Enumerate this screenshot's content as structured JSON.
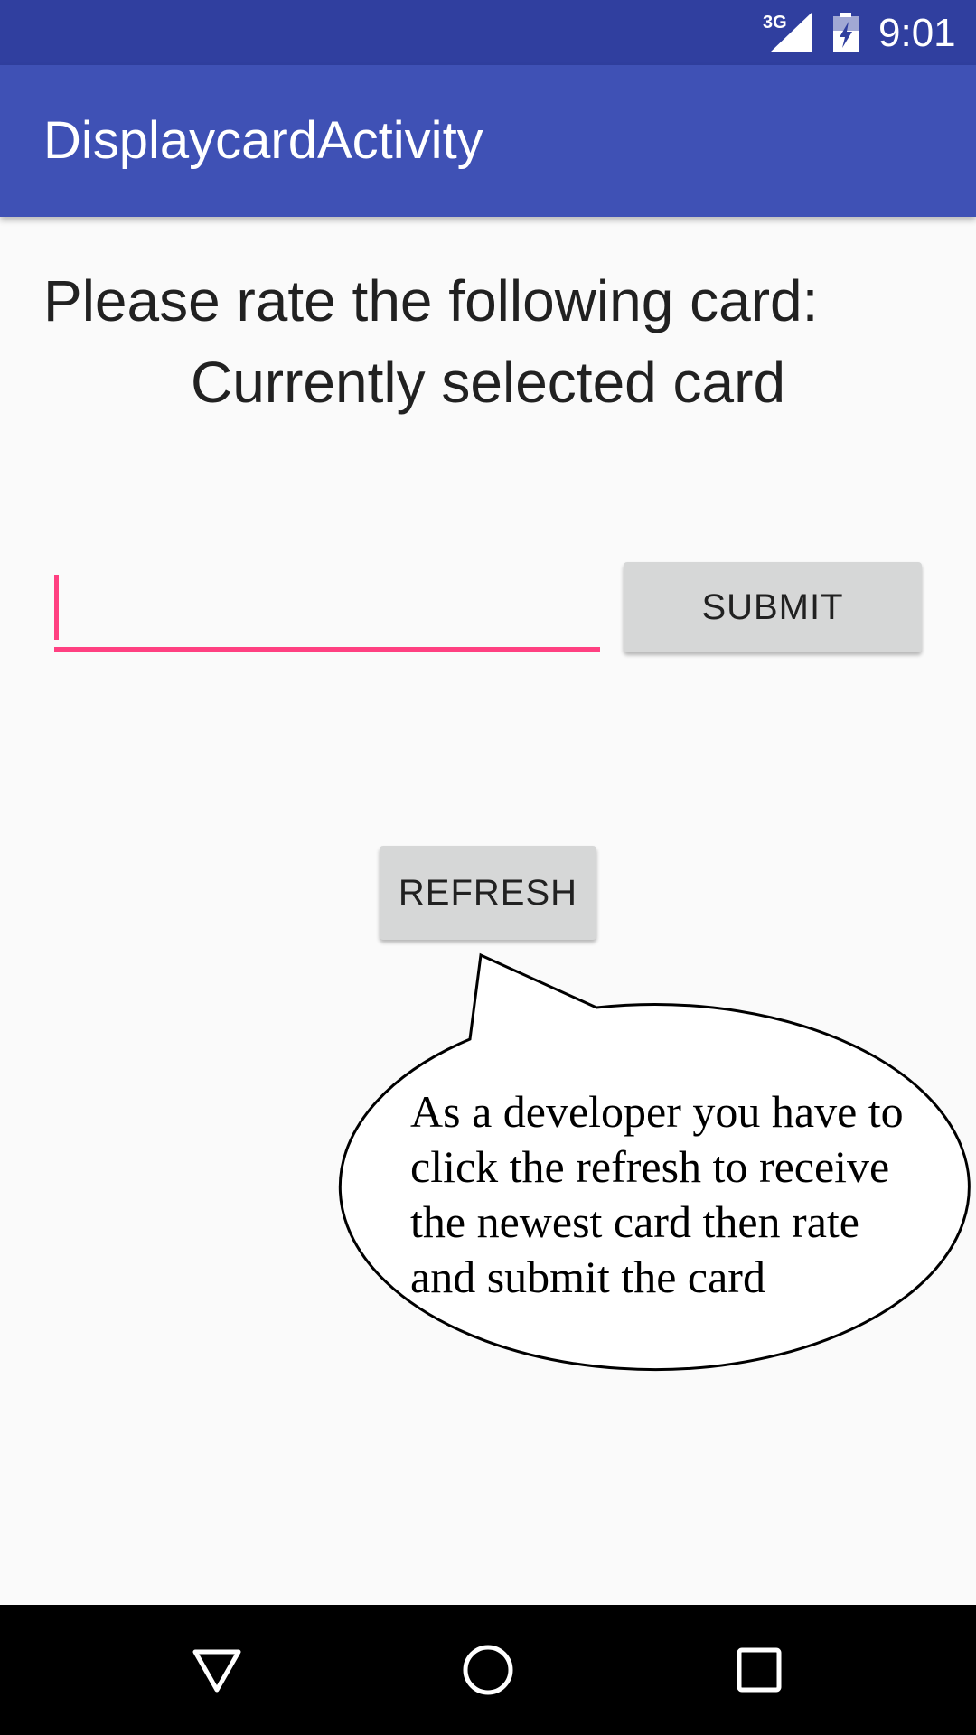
{
  "status_bar": {
    "network": "3G",
    "time": "9:01",
    "icons": [
      "signal-icon",
      "battery-charging-icon"
    ]
  },
  "app_bar": {
    "title": "DisplaycardActivity"
  },
  "main": {
    "prompt": "Please rate the following card:",
    "card_name": "Currently selected card",
    "rating_input": {
      "value": "",
      "placeholder": ""
    },
    "submit_label": "SUBMIT",
    "refresh_label": "REFRESH"
  },
  "callout": {
    "lines": [
      "As a developer you have to",
      "click the refresh to receive",
      "the newest card then rate",
      "and submit the card"
    ]
  },
  "nav_bar": {
    "icons": [
      "back-icon",
      "home-icon",
      "recents-icon"
    ]
  },
  "colors": {
    "status_bar": "#303f9f",
    "app_bar": "#3f51b5",
    "accent": "#ff4081",
    "background": "#fafafa",
    "button": "#d6d7d7"
  }
}
